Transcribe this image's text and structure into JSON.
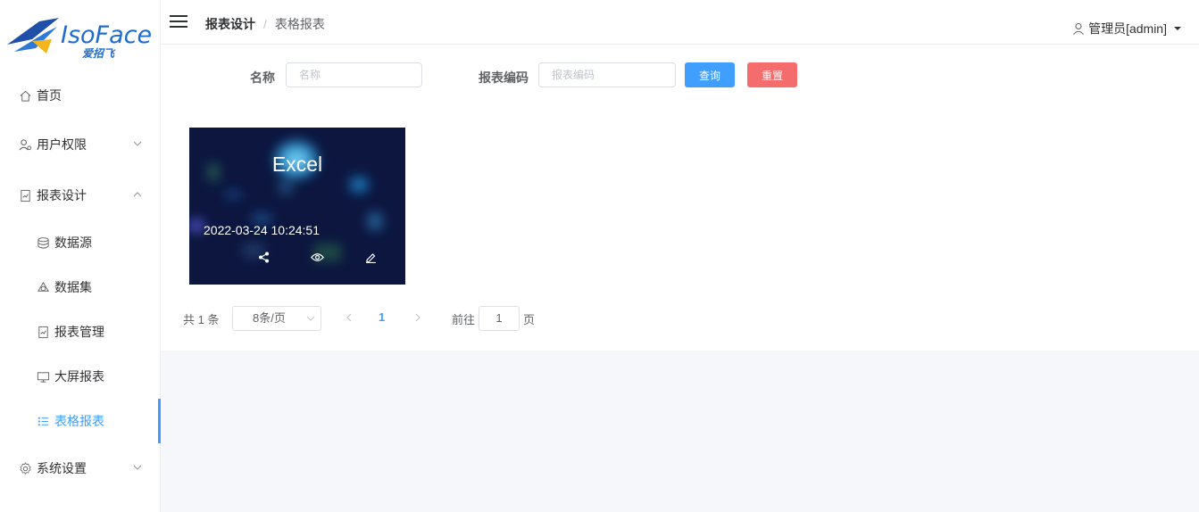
{
  "brand": {
    "logo_text": "IsoFace",
    "logo_sub": "爱招飞"
  },
  "sidebar": {
    "items": [
      {
        "label": "首页"
      },
      {
        "label": "用户权限"
      },
      {
        "label": "报表设计"
      },
      {
        "label": "数据源"
      },
      {
        "label": "数据集"
      },
      {
        "label": "报表管理"
      },
      {
        "label": "大屏报表"
      },
      {
        "label": "表格报表"
      },
      {
        "label": "系统设置"
      }
    ],
    "active_color": "#409eff"
  },
  "header": {
    "breadcrumb": [
      "报表设计",
      "表格报表"
    ],
    "breadcrumb_sep": "/",
    "user": "管理员[admin]"
  },
  "search": {
    "name_label": "名称",
    "name_placeholder": "名称",
    "code_label": "报表编码",
    "code_placeholder": "报表编码",
    "query_label": "查询",
    "reset_label": "重置"
  },
  "cards": [
    {
      "title": "Excel",
      "date": "2022-03-24 10:24:51"
    }
  ],
  "pagination": {
    "total": "共 1 条",
    "page_size": "8条/页",
    "current": "1",
    "goto_label": "前往",
    "goto_value": "1",
    "page_suffix": "页"
  }
}
